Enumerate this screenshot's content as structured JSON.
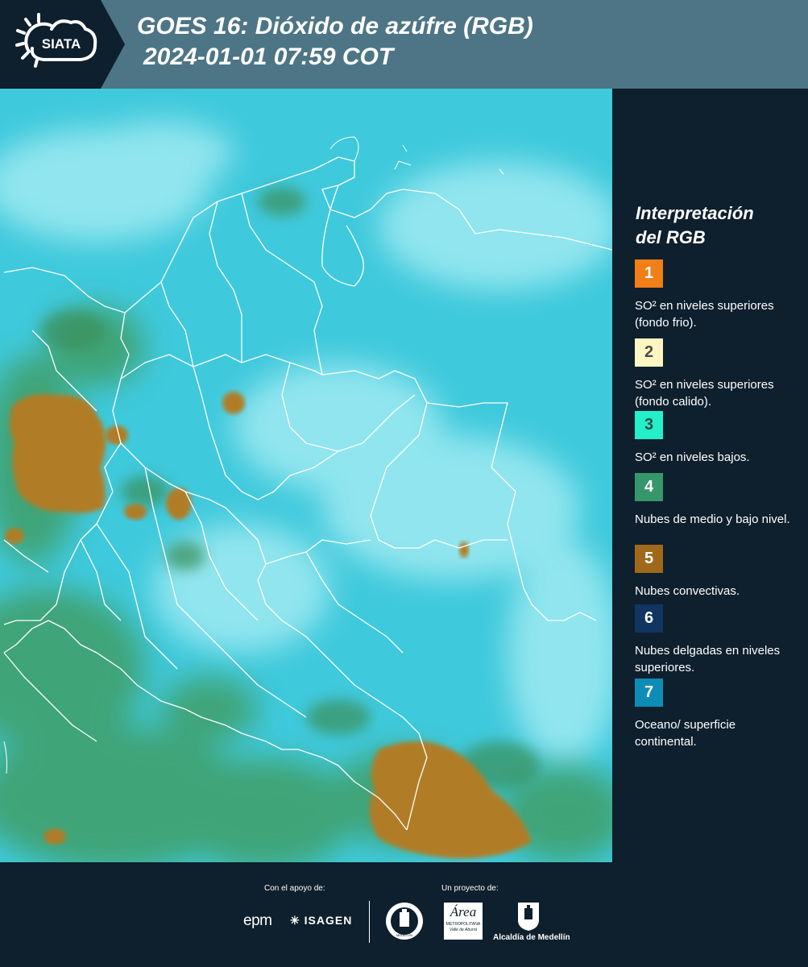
{
  "header": {
    "logo_text": "SIATA",
    "title_line1": "GOES 16: Dióxido de azúfre (RGB)",
    "title_line2": "2024-01-01 07:59 COT"
  },
  "legend": {
    "title_line1": "Interpretación",
    "title_line2": "del RGB",
    "items": [
      {
        "number": "1",
        "color": "#f07f17",
        "text_color": "#ffffff",
        "label": "SO² en niveles superiores (fondo frio)."
      },
      {
        "number": "2",
        "color": "#fef6c2",
        "text_color": "#4a4a4a",
        "label": "SO² en niveles superiores (fondo calido)."
      },
      {
        "number": "3",
        "color": "#23f0c8",
        "text_color": "#2a4a4a",
        "label": "SO² en niveles bajos."
      },
      {
        "number": "4",
        "color": "#36976a",
        "text_color": "#ffffff",
        "label": "Nubes de medio y bajo nivel."
      },
      {
        "number": "5",
        "color": "#a0681a",
        "text_color": "#ffffff",
        "label": "Nubes convectivas."
      },
      {
        "number": "6",
        "color": "#0f3560",
        "text_color": "#ffffff",
        "label": "Nubes delgadas en niveles superiores."
      },
      {
        "number": "7",
        "color": "#0d8cb6",
        "text_color": "#ffffff",
        "label": "Oceano/ superficie continental."
      }
    ]
  },
  "footer": {
    "support_label": "Con el apoyo de:",
    "project_label": "Un proyecto de:",
    "epm": "epm",
    "isagen": "ISAGEN",
    "area_metro_name": "Área",
    "area_metro_line1": "METROPOLITANA",
    "area_metro_line2": "Valle de Aburrá",
    "alcaldia": "Alcaldía de Medellín",
    "medellin_seal_text": "MEDELLÍN"
  },
  "colors": {
    "background": "#0e1f2d",
    "header_band": "#4d7585",
    "map_base": "#3fc9dc",
    "cloud_light": "#9ee9f2",
    "cloud_green": "#3f9e66",
    "cloud_convective": "#b07d25",
    "borders": "#ffffff"
  }
}
